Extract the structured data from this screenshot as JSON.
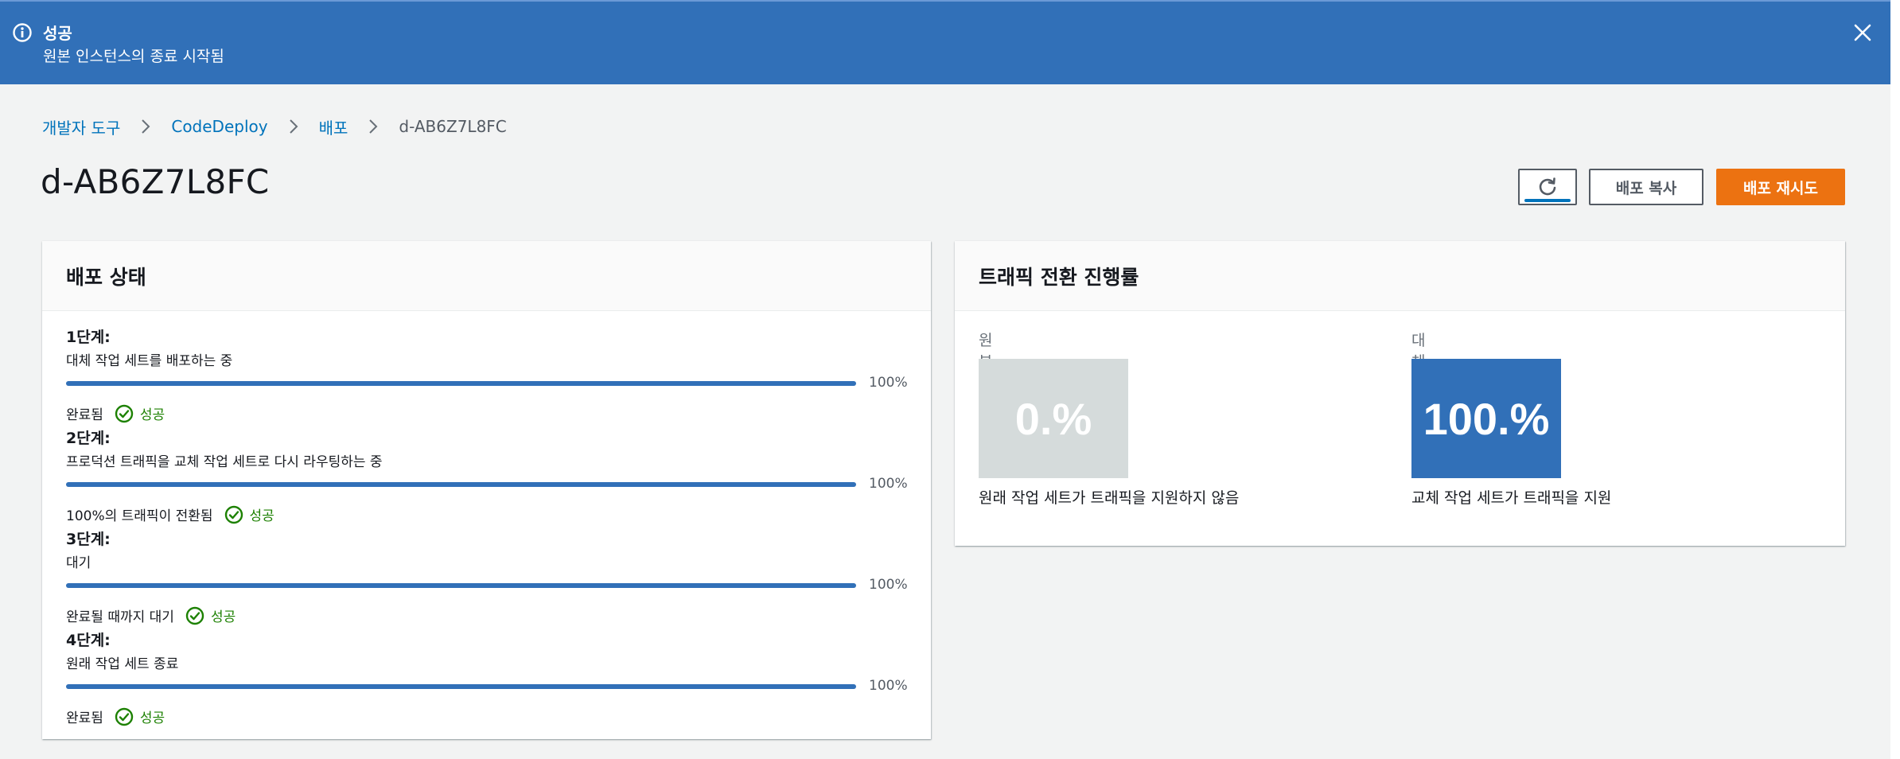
{
  "colors": {
    "flash_bg": "#3170b8",
    "link": "#0073bb",
    "primary_button": "#ec7211",
    "progress": "#3170b8",
    "success": "#1d8102",
    "replacement_box": "#3170b8",
    "original_box": "#d5dbdb"
  },
  "flash": {
    "icon": "info-icon",
    "title": "성공",
    "message": "원본 인스턴스의 종료 시작됨",
    "close_icon": "close-icon"
  },
  "breadcrumb": {
    "items": [
      "개발자 도구",
      "CodeDeploy",
      "배포"
    ],
    "current": "d-AB6Z7L8FC"
  },
  "page": {
    "title": "d-AB6Z7L8FC"
  },
  "buttons": {
    "refresh_icon": "refresh-icon",
    "copy": "배포 복사",
    "retry": "배포 재시도"
  },
  "deployment_status": {
    "title": "배포 상태",
    "phases": [
      {
        "title": "1단계:",
        "description": "대체 작업 세트를 배포하는 중",
        "progress": 100,
        "progress_label": "100%",
        "status": "완료됨",
        "result": "성공"
      },
      {
        "title": "2단계:",
        "description": "프로덕션 트래픽을 교체 작업 세트로 다시 라우팅하는 중",
        "progress": 100,
        "progress_label": "100%",
        "status": "100%의 트래픽이 전환됨",
        "result": "성공"
      },
      {
        "title": "3단계:",
        "description": "대기",
        "progress": 100,
        "progress_label": "100%",
        "status": "완료될 때까지 대기",
        "result": "성공"
      },
      {
        "title": "4단계:",
        "description": "원래 작업 세트 종료",
        "progress": 100,
        "progress_label": "100%",
        "status": "완료됨",
        "result": "성공"
      }
    ]
  },
  "traffic": {
    "title": "트래픽 전환 진행률",
    "original": {
      "label": "원본",
      "value": "0.%",
      "caption": "원래 작업 세트가 트래픽을 지원하지 않음"
    },
    "replacement": {
      "label": "대체",
      "value": "100.%",
      "caption": "교체 작업 세트가 트래픽을 지원"
    }
  }
}
